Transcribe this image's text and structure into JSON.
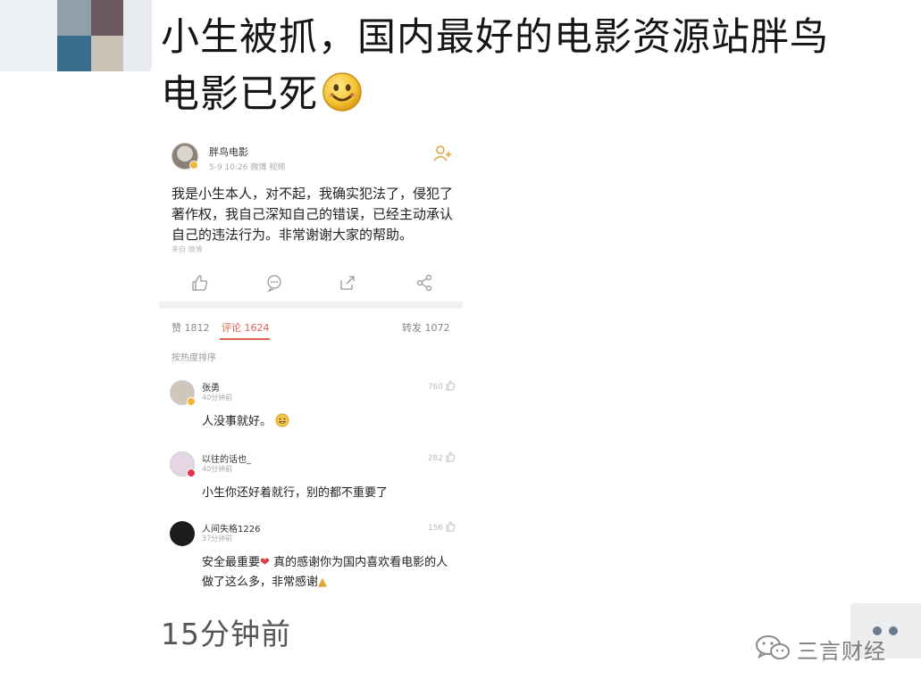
{
  "post": {
    "line1": "小生被抓，国内最好的电影资源站胖鸟",
    "line2": "电影已死",
    "emoji": "smiling-face-emoji",
    "timestamp": "15分钟前"
  },
  "screenshot": {
    "account_name": "胖鸟电影",
    "account_meta": "5-9 10:26    微博 视频",
    "body": "我是小生本人，对不起，我确实犯法了，侵犯了著作权，我自己深知自己的错误，已经主动承认自己的违法行为。非常谢谢大家的帮助。",
    "source": "来自 微博",
    "tabs": {
      "likes": "赞 1812",
      "comments": "评论 1624",
      "reposts": "转发 1072"
    },
    "sort_label": "按热度排序",
    "comments": [
      {
        "name": "张勇",
        "time": "40分钟前",
        "likes": "760",
        "text": "人没事就好。",
        "avatar_color": "#cfc7bb",
        "badge_color": "#f3b63c"
      },
      {
        "name": "以往的话也_",
        "time": "40分钟前",
        "likes": "282",
        "text": "小生你还好着就行，别的都不重要了",
        "avatar_color": "#e6d6e4",
        "badge_color": "#e0394a"
      },
      {
        "name": "人间失格1226",
        "time": "37分钟前",
        "likes": "156",
        "text": "安全最重要",
        "text2": "真的感谢你为国内喜欢看电影的人做了这么多，非常感谢",
        "avatar_color": "#1c1c1c",
        "badge_color": ""
      }
    ]
  },
  "watermark": {
    "text": "三言财经",
    "icon": "wechat-icon"
  },
  "more_button_icon": "more-dots-icon",
  "colors": {
    "accent": "#e0614f",
    "timestamp": "#555555",
    "dots": "#6b7a8f"
  }
}
